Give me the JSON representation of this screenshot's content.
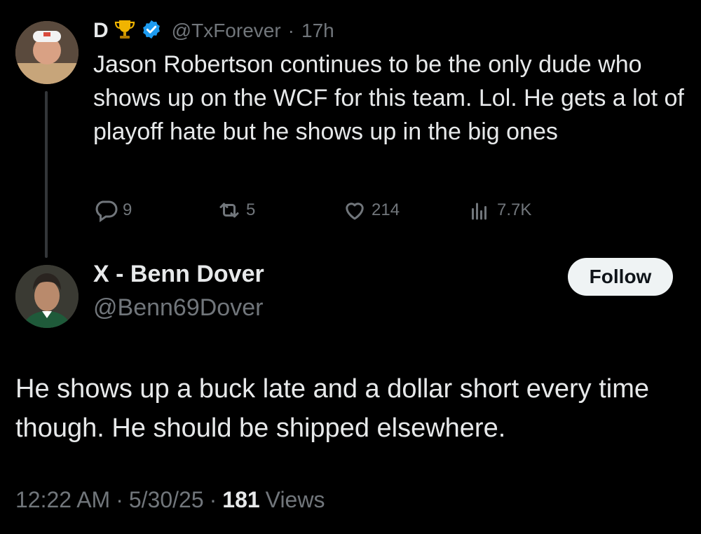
{
  "parent_tweet": {
    "display_name": "D",
    "handle": "@TxForever",
    "separator": "·",
    "time": "17h",
    "text": "Jason Robertson continues to be the only dude who shows up on the WCF for this team. Lol. He gets a lot of playoff hate but he shows up in the big ones",
    "actions": {
      "replies": "9",
      "reposts": "5",
      "likes": "214",
      "views": "7.7K"
    }
  },
  "reply_tweet": {
    "display_name": "X - Benn Dover",
    "handle": "@Benn69Dover",
    "follow_label": "Follow",
    "text": "He shows up a buck late and a dollar short every time though. He should be shipped elsewhere.",
    "timestamp": "12:22 AM",
    "date": "5/30/25",
    "separator": "·",
    "views_count": "181",
    "views_label": "Views"
  },
  "colors": {
    "background": "#000000",
    "text": "#e7e9ea",
    "muted": "#71767b",
    "verified": "#1d9bf0",
    "trophy": "#f0b400"
  },
  "icons": [
    "trophy-icon",
    "verified-badge-icon",
    "reply-icon",
    "repost-icon",
    "like-icon",
    "views-icon"
  ]
}
